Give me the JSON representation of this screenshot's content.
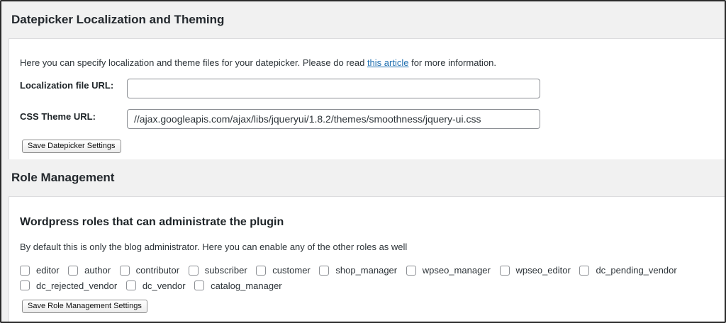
{
  "datepicker": {
    "title": "Datepicker Localization and Theming",
    "intro_before": "Here you can specify localization and theme files for your datepicker. Please do read ",
    "intro_link": "this article",
    "intro_after": " for more information.",
    "localization_label": "Localization file URL:",
    "localization_value": "",
    "css_theme_label": "CSS Theme URL:",
    "css_theme_value": "//ajax.googleapis.com/ajax/libs/jqueryui/1.8.2/themes/smoothness/jquery-ui.css",
    "save_label": "Save Datepicker Settings"
  },
  "roles": {
    "title": "Role Management",
    "subtitle": "Wordpress roles that can administrate the plugin",
    "description": "By default this is only the blog administrator. Here you can enable any of the other roles as well",
    "items": [
      {
        "label": "editor",
        "checked": false
      },
      {
        "label": "author",
        "checked": false
      },
      {
        "label": "contributor",
        "checked": false
      },
      {
        "label": "subscriber",
        "checked": false
      },
      {
        "label": "customer",
        "checked": false
      },
      {
        "label": "shop_manager",
        "checked": false
      },
      {
        "label": "wpseo_manager",
        "checked": false
      },
      {
        "label": "wpseo_editor",
        "checked": false
      },
      {
        "label": "dc_pending_vendor",
        "checked": false
      },
      {
        "label": "dc_rejected_vendor",
        "checked": false
      },
      {
        "label": "dc_vendor",
        "checked": false
      },
      {
        "label": "catalog_manager",
        "checked": false
      }
    ],
    "save_label": "Save Role Management Settings"
  }
}
